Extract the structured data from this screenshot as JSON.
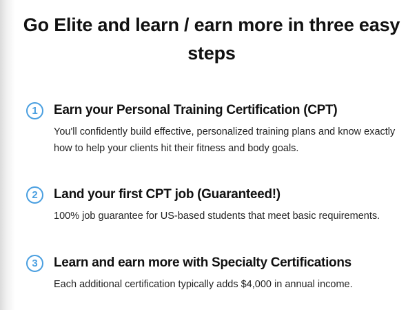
{
  "headline": "Go Elite and learn / earn more in three easy steps",
  "accent_color": "#4a9fe0",
  "steps": [
    {
      "number": "1",
      "title": "Earn your Personal Training Certification (CPT)",
      "description": "You'll confidently build effective, personalized training plans and know exactly how to help your clients hit their fitness and body goals."
    },
    {
      "number": "2",
      "title": "Land your first CPT job (Guaranteed!)",
      "description": "100% job guarantee for US-based students that meet basic requirements."
    },
    {
      "number": "3",
      "title": "Learn and earn more with Specialty Certifications",
      "description": "Each additional certification typically adds $4,000 in annual income."
    }
  ]
}
